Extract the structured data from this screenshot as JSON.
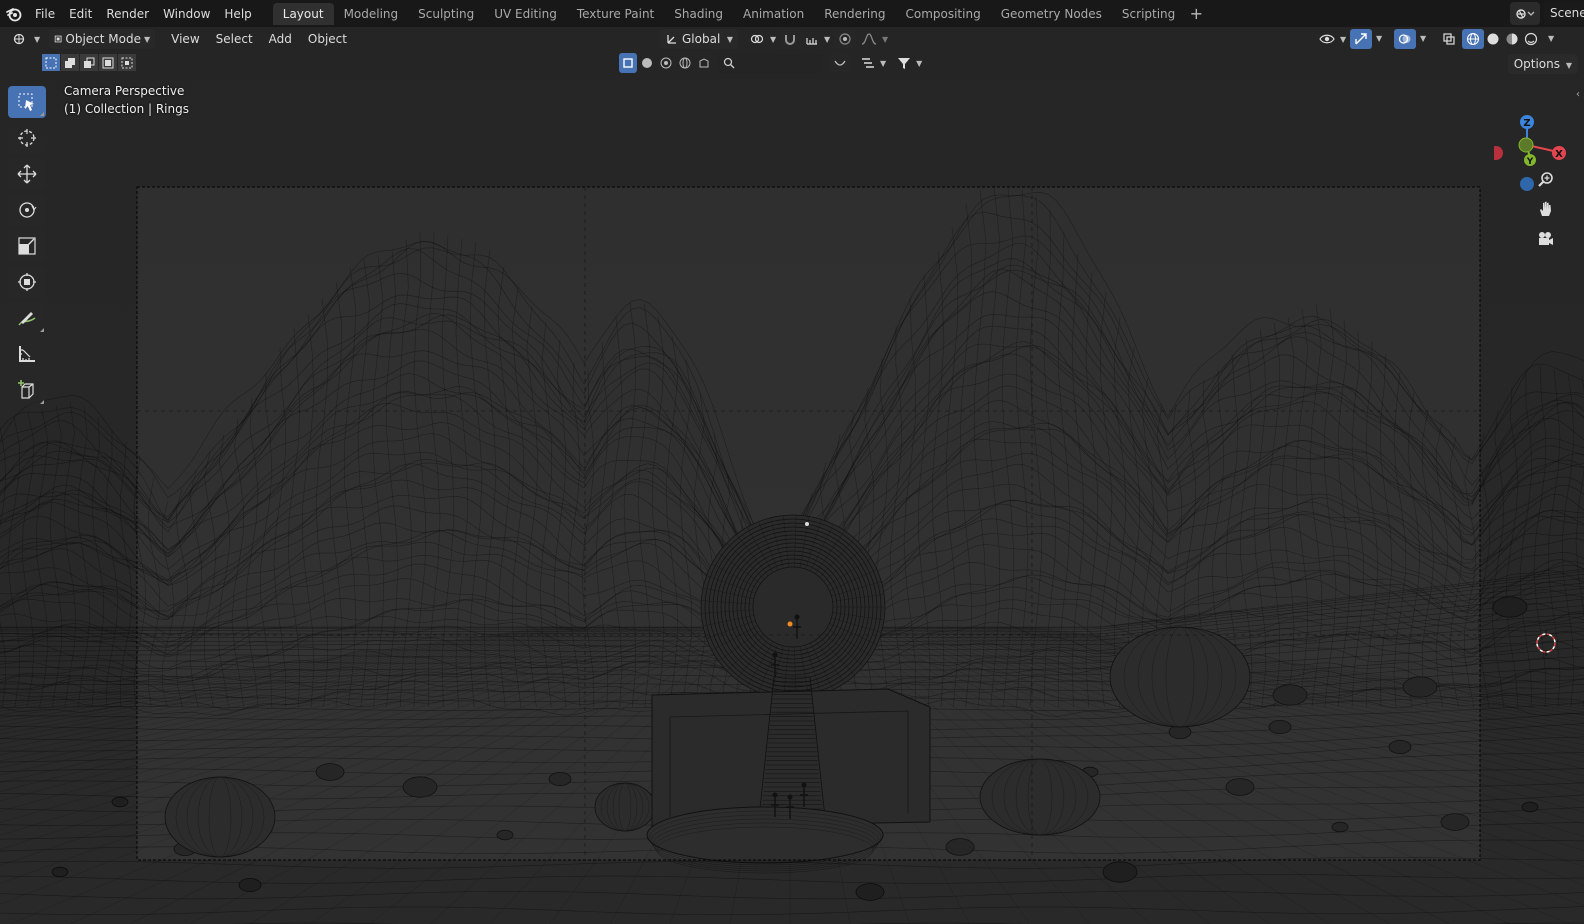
{
  "app": {
    "menu": [
      "File",
      "Edit",
      "Render",
      "Window",
      "Help"
    ],
    "workspaces": [
      "Layout",
      "Modeling",
      "Sculpting",
      "UV Editing",
      "Texture Paint",
      "Shading",
      "Animation",
      "Rendering",
      "Compositing",
      "Geometry Nodes",
      "Scripting"
    ],
    "active_workspace": "Layout",
    "add_workspace": "+",
    "scene_name": "Scene"
  },
  "viewport_header": {
    "mode": "Object Mode",
    "menus": [
      "View",
      "Select",
      "Add",
      "Object"
    ],
    "transform_orientation": "Global",
    "options_label": "Options",
    "search_placeholder": ""
  },
  "viewport_overlay": {
    "view_name": "Camera Perspective",
    "collection_info": "(1) Collection | Rings"
  },
  "gizmo": {
    "axes": {
      "x": "X",
      "y": "Y",
      "z": "Z"
    },
    "colors": {
      "x": "#e3464f",
      "y": "#84b82c",
      "z": "#3c85dc"
    }
  },
  "toolbar": {
    "tools": [
      "select-box-tool",
      "cursor-tool",
      "move-tool",
      "rotate-tool",
      "scale-tool",
      "transform-tool",
      "annotate-tool",
      "measure-tool",
      "add-cube-tool"
    ],
    "active_tool": "select-box-tool"
  },
  "colors": {
    "accent": "#4772b3",
    "viewport_bg": "#303030",
    "topbar_bg": "#181818",
    "wire": "#111111"
  }
}
